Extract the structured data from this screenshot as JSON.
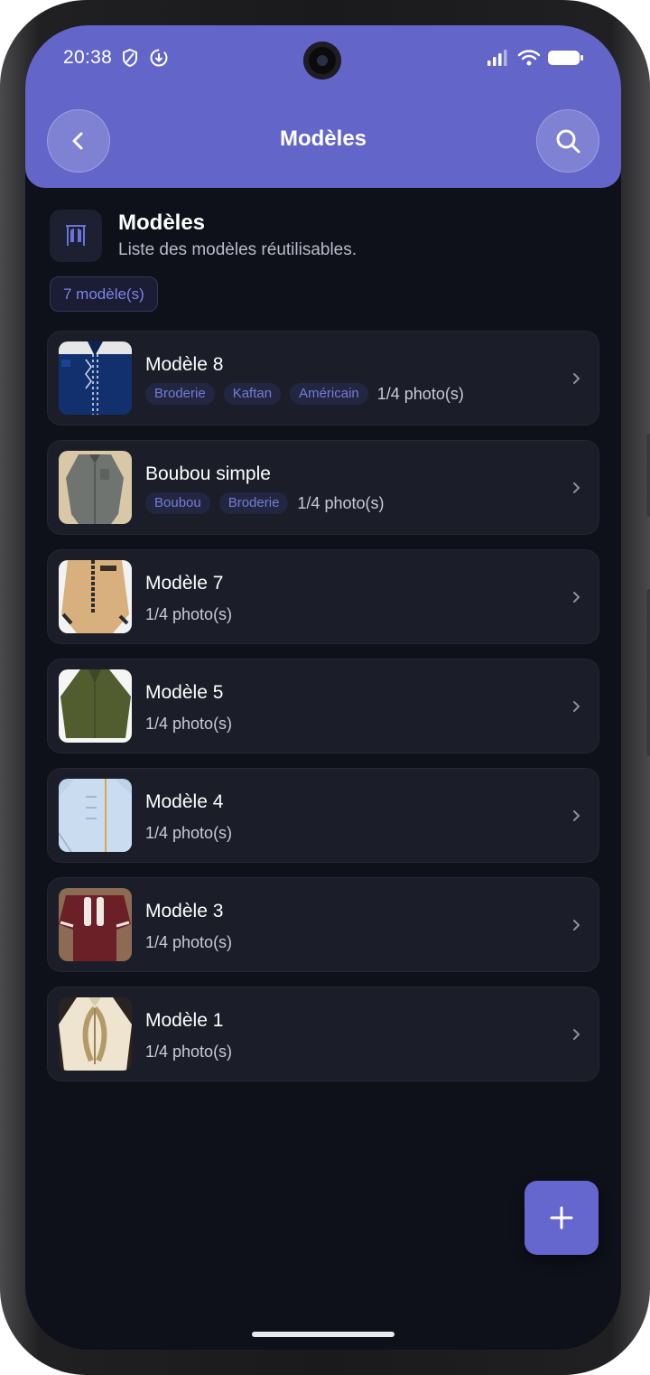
{
  "status_bar": {
    "time": "20:38"
  },
  "app_bar": {
    "title": "Modèles"
  },
  "header": {
    "title": "Modèles",
    "subtitle": "Liste des modèles réutilisables.",
    "count_badge": "7 modèle(s)"
  },
  "models": [
    {
      "title": "Modèle 8",
      "tags": [
        "Broderie",
        "Kaftan",
        "Américain"
      ],
      "photos": "1/4 photo(s)"
    },
    {
      "title": "Boubou simple",
      "tags": [
        "Boubou",
        "Broderie"
      ],
      "photos": "1/4 photo(s)"
    },
    {
      "title": "Modèle 7",
      "tags": [],
      "photos": "1/4 photo(s)"
    },
    {
      "title": "Modèle 5",
      "tags": [],
      "photos": "1/4 photo(s)"
    },
    {
      "title": "Modèle 4",
      "tags": [],
      "photos": "1/4 photo(s)"
    },
    {
      "title": "Modèle 3",
      "tags": [],
      "photos": "1/4 photo(s)"
    },
    {
      "title": "Modèle 1",
      "tags": [],
      "photos": "1/4 photo(s)"
    }
  ],
  "colors": {
    "accent": "#6366c8",
    "background": "#0e1119",
    "card": "#1b1e29",
    "chip_text": "#767bd6"
  }
}
